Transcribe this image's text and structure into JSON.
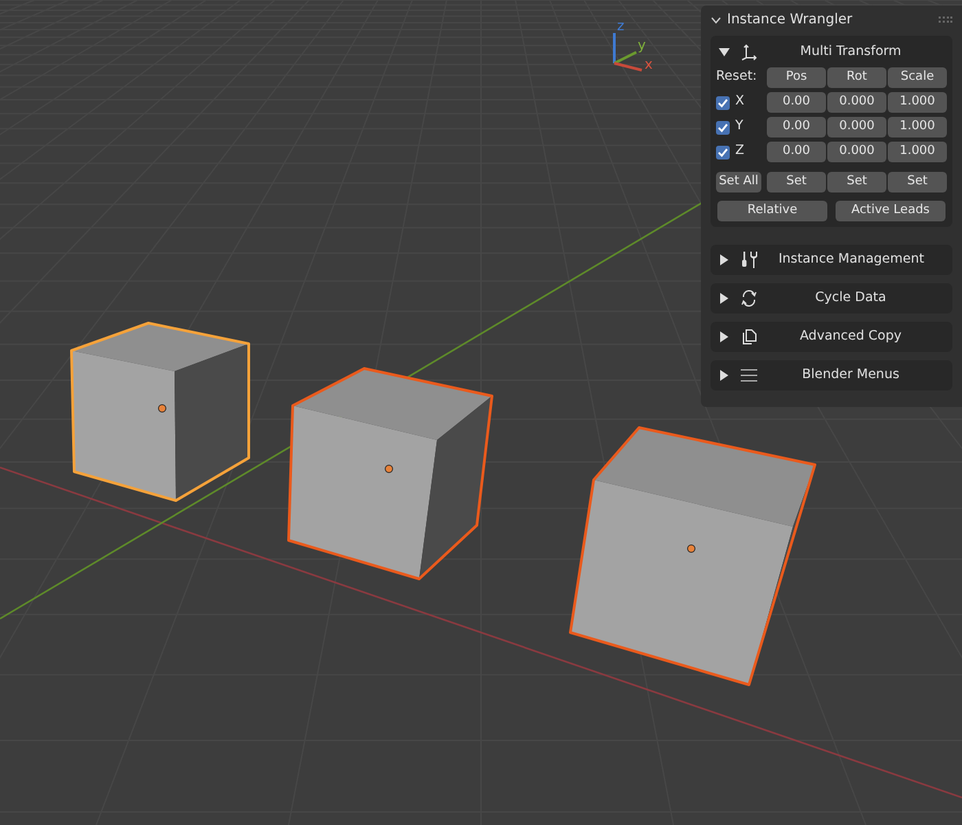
{
  "viewport": {
    "gizmo_labels": [
      "z",
      "y",
      "x"
    ],
    "cubes": [
      {
        "selected": true,
        "active": true
      },
      {
        "selected": true,
        "active": false
      },
      {
        "selected": true,
        "active": false
      }
    ]
  },
  "panel": {
    "title": "Instance Wrangler",
    "expanded": true,
    "multi_transform": {
      "title": "Multi Transform",
      "expanded": true,
      "reset_label": "Reset:",
      "reset_buttons": [
        "Pos",
        "Rot",
        "Scale"
      ],
      "axes": [
        {
          "label": "X",
          "checked": true,
          "values": [
            "0.00",
            "0.000",
            "1.000"
          ]
        },
        {
          "label": "Y",
          "checked": true,
          "values": [
            "0.00",
            "0.000",
            "1.000"
          ]
        },
        {
          "label": "Z",
          "checked": true,
          "values": [
            "0.00",
            "0.000",
            "1.000"
          ]
        }
      ],
      "set_all": "Set All",
      "set_buttons": [
        "Set",
        "Set",
        "Set"
      ],
      "bottom_buttons": [
        "Relative",
        "Active Leads"
      ]
    },
    "subpanels": [
      {
        "title": "Instance Management",
        "kind": "tools",
        "expanded": false
      },
      {
        "title": "Cycle Data",
        "kind": "cycle",
        "expanded": false
      },
      {
        "title": "Advanced Copy",
        "kind": "copy",
        "expanded": false
      },
      {
        "title": "Blender Menus",
        "kind": "menu",
        "expanded": false
      }
    ]
  }
}
